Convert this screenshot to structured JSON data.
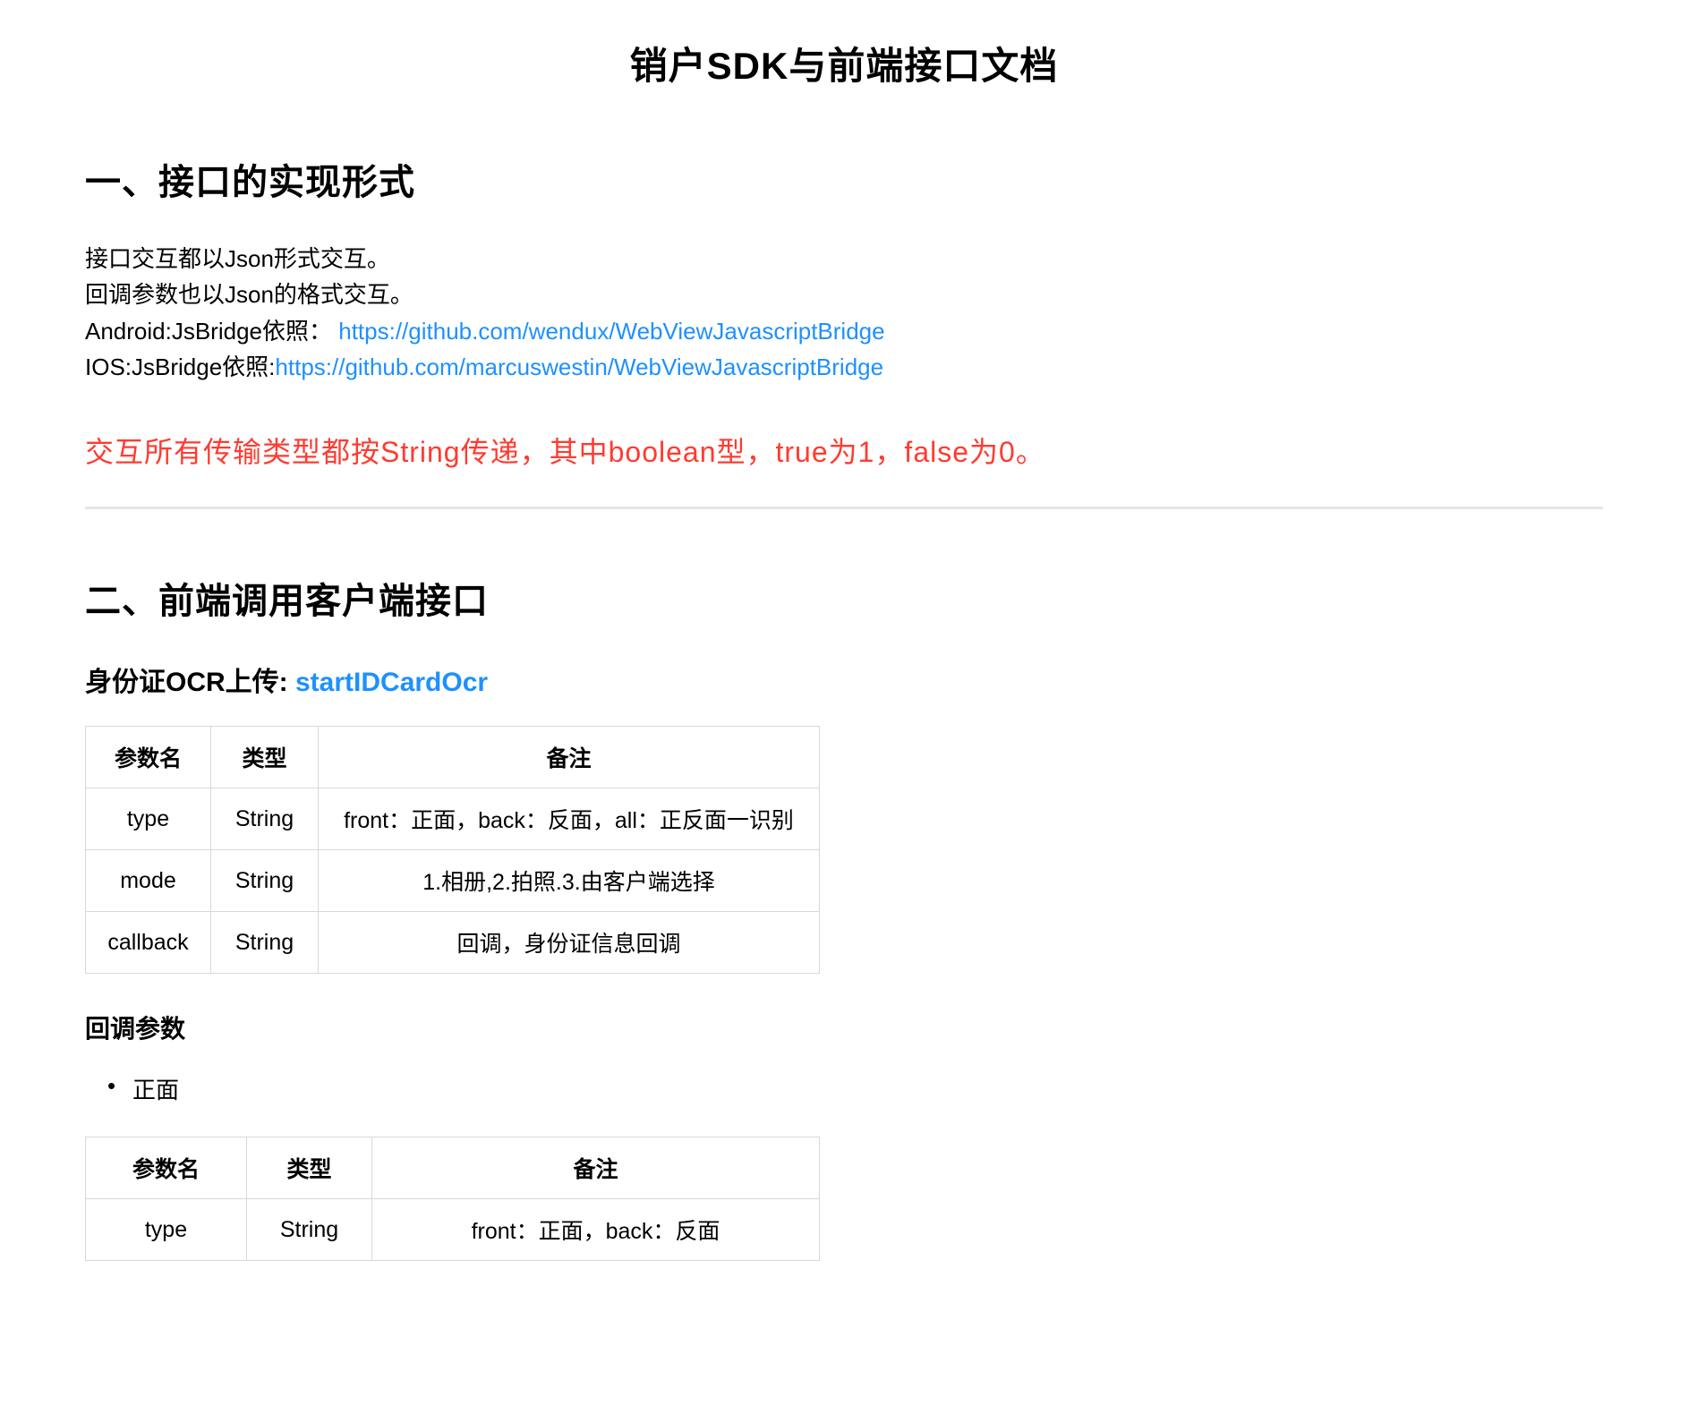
{
  "doc_title": "销户SDK与前端接口文档",
  "section1": {
    "heading": "一、接口的实现形式",
    "intro_line1": "接口交互都以Json形式交互。",
    "intro_line2": "回调参数也以Json的格式交互。",
    "android_prefix": "Android:JsBridge依照：",
    "android_link": "https://github.com/wendux/WebViewJavascriptBridge",
    "ios_prefix": "IOS:JsBridge依照:",
    "ios_link": "https://github.com/marcuswestin/WebViewJavascriptBridge",
    "warning": "交互所有传输类型都按String传递，其中boolean型，true为1，false为0。"
  },
  "section2": {
    "heading": "二、前端调用客户端接口",
    "sub_heading_prefix": "身份证OCR上传: ",
    "sub_heading_method": "startIDCardOcr",
    "table1": {
      "headers": [
        "参数名",
        "类型",
        "备注"
      ],
      "rows": [
        [
          "type",
          "String",
          "front：正面，back：反面，all：正反面一识别"
        ],
        [
          "mode",
          "String",
          "1.相册,2.拍照.3.由客户端选择"
        ],
        [
          "callback",
          "String",
          "回调，身份证信息回调"
        ]
      ]
    },
    "callback_heading": "回调参数",
    "bullet_item": "正面",
    "table2": {
      "headers": [
        "参数名",
        "类型",
        "备注"
      ],
      "rows": [
        [
          "type",
          "String",
          "front：正面，back：反面"
        ]
      ]
    }
  }
}
